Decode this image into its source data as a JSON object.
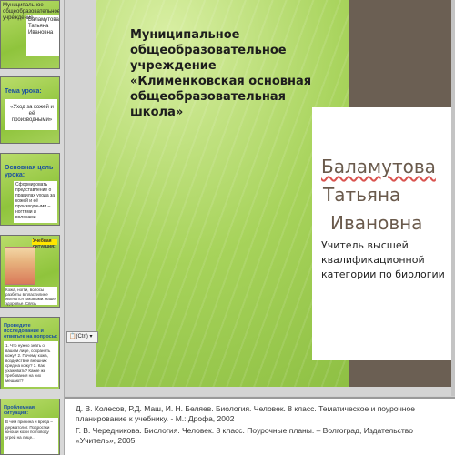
{
  "thumbnails": [
    {
      "lines": [
        "Муниципальное общеобразовательное учреждение",
        "Баламутова Татьяна Ивановна"
      ]
    },
    {
      "title": "Тема урока:",
      "text": "«Уход за кожей и её производными»"
    },
    {
      "title": "Основная цель урока:",
      "text": "Сформировать представление о правилах ухода за кожей и её производными – ногтями и волосами"
    },
    {
      "title": "Учебная ситуация:",
      "text": "Кожа, ногти, волосы разбиты в пластилине являются таковыми: наше здоровье. Связь"
    },
    {
      "title": "Проведите исследование и ответьте на вопросы:",
      "text": "1. Что нужно знать о вашем лице, сохранить кожу? 2. Почему кожа, воздействие внешних сред на кожу? 3. Как ухаживать? Какие же требования на них мешают?"
    },
    {
      "title": "Проблемная ситуация:",
      "text": "В чем причина и вреда – дерматолог. Подростки юноши кожи по поводу угрей на лице..."
    }
  ],
  "slide": {
    "organization": "Муниципальное общеобразовательное учреждение «Клименковская основная общеобразовательная школа»",
    "name_line1": "Баламутова",
    "name_line2": "Татьяна",
    "name_line3": "Ивановна",
    "subtitle": "Учитель высшей квалификационной категории по биологии",
    "paste_label": "(Ctrl) ▾"
  },
  "notes": {
    "line1": "Д. В. Колесов, Р.Д. Маш, И. Н. Беляев. Биология. Человек. 8 класс. Тематическое и поурочное планирование к учебнику. - М.: Дрофа, 2002",
    "line2": "Г. В. Чередникова. Биология. Человек. 8 класс. Поурочные планы. – Волгоград, Издательство «Учитель», 2005"
  },
  "colors": {
    "slide_green": "#a7d35b",
    "panel_brown": "#6b5f53",
    "name_brown": "#6a5a4c",
    "thumb_title_blue": "#1a4fa0"
  }
}
